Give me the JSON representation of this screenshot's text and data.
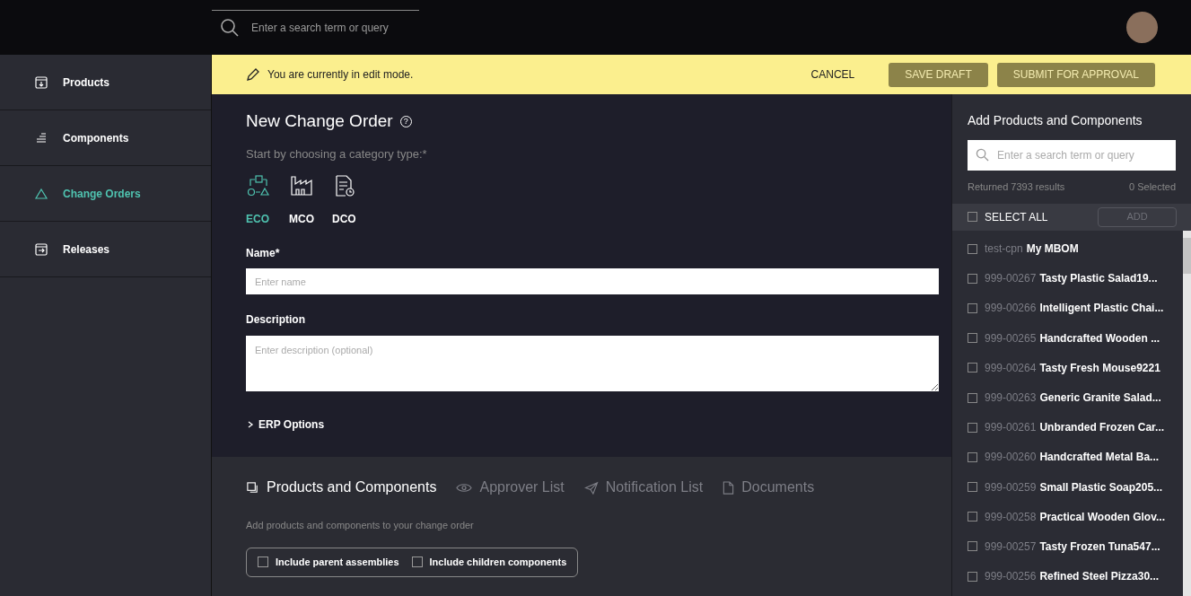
{
  "topbar": {
    "search": {
      "placeholder": "Enter a search term or query"
    }
  },
  "sidebar": {
    "items": [
      {
        "label": "Products",
        "kind": "products",
        "selected": false
      },
      {
        "label": "Components",
        "kind": "components",
        "selected": false
      },
      {
        "label": "Change Orders",
        "kind": "changes",
        "selected": true
      },
      {
        "label": "Releases",
        "kind": "releases",
        "selected": false
      }
    ]
  },
  "edit_banner": {
    "message": "You are currently in edit mode.",
    "buttons": [
      {
        "label": "CANCEL",
        "kind": "text"
      },
      {
        "label": "SAVE DRAFT",
        "kind": "filled"
      },
      {
        "label": "SUBMIT FOR APPROVAL",
        "kind": "filled"
      }
    ]
  },
  "form": {
    "title": "New Change Order",
    "help": "?",
    "category_prompt": "Start by choosing a category type:*",
    "categories": [
      {
        "label": "ECO",
        "kind": "eco",
        "selected": true
      },
      {
        "label": "MCO",
        "kind": "mco",
        "selected": false
      },
      {
        "label": "DCO",
        "kind": "dco",
        "selected": false
      }
    ],
    "name": {
      "label": "Name*",
      "placeholder": "Enter name"
    },
    "description": {
      "label": "Description",
      "placeholder": "Enter description (optional)"
    },
    "erp_options": {
      "label": "ERP Options",
      "expanded": false
    }
  },
  "tabs": [
    {
      "label": "Products and Components",
      "kind": "stack",
      "selected": true
    },
    {
      "label": "Approver List",
      "kind": "eye",
      "selected": false
    },
    {
      "label": "Notification List",
      "kind": "send",
      "selected": false
    },
    {
      "label": "Documents",
      "kind": "doc",
      "selected": false
    }
  ],
  "tab_content": {
    "hint": "Add products and components to your change order",
    "options": [
      {
        "label": "Include parent assemblies",
        "checked": false
      },
      {
        "label": "Include children components",
        "checked": false
      }
    ]
  },
  "add_panel": {
    "title": "Add Products and Components",
    "search": {
      "placeholder": "Enter a search term or query"
    },
    "results": "Returned 7393 results",
    "selected_count": "0 Selected",
    "select_all": {
      "label": "SELECT ALL",
      "checked": false
    },
    "add_button": {
      "label": "ADD",
      "disabled": true
    },
    "items": [
      {
        "cpn": "test-cpn",
        "name": "My MBOM",
        "checked": false
      },
      {
        "cpn": "999-00267",
        "name": "Tasty Plastic Salad19...",
        "checked": false
      },
      {
        "cpn": "999-00266",
        "name": "Intelligent Plastic Chai...",
        "checked": false
      },
      {
        "cpn": "999-00265",
        "name": "Handcrafted Wooden ...",
        "checked": false
      },
      {
        "cpn": "999-00264",
        "name": "Tasty Fresh Mouse9221",
        "checked": false
      },
      {
        "cpn": "999-00263",
        "name": "Generic Granite Salad...",
        "checked": false
      },
      {
        "cpn": "999-00261",
        "name": "Unbranded Frozen Car...",
        "checked": false
      },
      {
        "cpn": "999-00260",
        "name": "Handcrafted Metal Ba...",
        "checked": false
      },
      {
        "cpn": "999-00259",
        "name": "Small Plastic Soap205...",
        "checked": false
      },
      {
        "cpn": "999-00258",
        "name": "Practical Wooden Glov...",
        "checked": false
      },
      {
        "cpn": "999-00257",
        "name": "Tasty Frozen Tuna547...",
        "checked": false
      },
      {
        "cpn": "999-00256",
        "name": "Refined Steel Pizza30...",
        "checked": false
      }
    ]
  }
}
